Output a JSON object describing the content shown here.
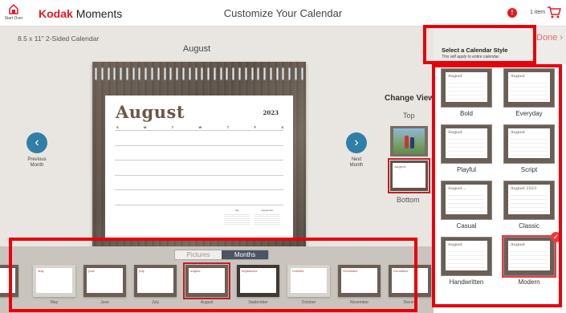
{
  "header": {
    "start_over": "Start Over",
    "brand_kodak": "Kodak",
    "brand_moments": "Moments",
    "title": "Customize Your Calendar",
    "alert_badge": "!",
    "cart_count": "1 item"
  },
  "product": {
    "name": "8.5 x 11\" 2-Sided Calendar",
    "month": "August"
  },
  "calendar": {
    "month": "August",
    "year": "2023",
    "weekdays": [
      "S",
      "M",
      "T",
      "W",
      "T",
      "F",
      "S"
    ],
    "mini": [
      {
        "title": "July"
      },
      {
        "title": "September"
      }
    ]
  },
  "nav": {
    "prev": "‹",
    "prev_label_1": "Previous",
    "prev_label_2": "Month",
    "next": "›",
    "next_label_1": "Next",
    "next_label_2": "Month"
  },
  "view": {
    "title": "Change View",
    "top": "Top",
    "bottom": "Bottom",
    "bottom_thumb_text": "August"
  },
  "panel": {
    "title": "Select a Calendar Style",
    "subtitle": "This will apply to entire calendar.",
    "done": "Done",
    "styles": [
      {
        "label": "Bold",
        "preview": "August"
      },
      {
        "label": "Everyday",
        "preview": "August"
      },
      {
        "label": "Playful",
        "preview": "August"
      },
      {
        "label": "Script",
        "preview": "August"
      },
      {
        "label": "Casual",
        "preview": "August..."
      },
      {
        "label": "Classic",
        "preview": "August 2023"
      },
      {
        "label": "Handwritten",
        "preview": "August"
      },
      {
        "label": "Modern",
        "preview": "August"
      }
    ],
    "selected": "Modern"
  },
  "strip": {
    "tabs": [
      "Pictures",
      "Months"
    ],
    "active_tab": "Months",
    "months": [
      {
        "label": "",
        "preview": ""
      },
      {
        "label": "May",
        "preview": "May"
      },
      {
        "label": "June",
        "preview": "June"
      },
      {
        "label": "July",
        "preview": "July"
      },
      {
        "label": "August",
        "preview": "August"
      },
      {
        "label": "September",
        "preview": "September"
      },
      {
        "label": "October",
        "preview": "October"
      },
      {
        "label": "November",
        "preview": "November"
      },
      {
        "label": "Decem",
        "preview": "December"
      }
    ],
    "selected_month": "August"
  },
  "colors": {
    "accent": "#e21b23",
    "nav": "#2f7fa6",
    "highlight": "#e8000b",
    "tab_active": "#4b5563"
  }
}
